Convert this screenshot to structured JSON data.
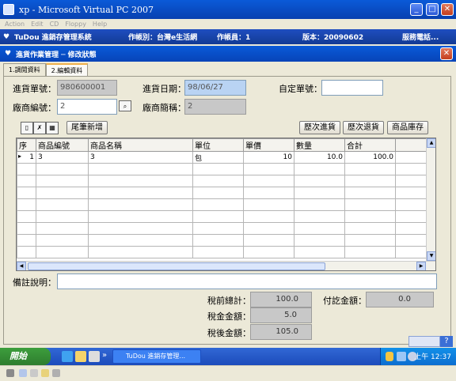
{
  "vpc": {
    "title": "xp - Microsoft Virtual PC 2007",
    "menu": [
      "Action",
      "Edit",
      "CD",
      "Floppy",
      "Help"
    ]
  },
  "app": {
    "system_name": "TuDou 進銷存管理系統",
    "account": "作帳別：台灣e生活網",
    "operator": "作帳員：1",
    "version": "版本：20090602",
    "service_phone": "服務電話..."
  },
  "window": {
    "title": "進貨作業管理 ─ 修改狀態"
  },
  "tabs": [
    "1.調閱資料",
    "2.編輯資料"
  ],
  "form": {
    "purchase_no_label": "進貨單號：",
    "purchase_no": "980600001",
    "purchase_date_label": "進貨日期：",
    "purchase_date": "98/06/27",
    "custom_no_label": "自定單號：",
    "custom_no": "",
    "vendor_no_label": "廠商編號：",
    "vendor_no": "2",
    "vendor_name_label": "廠商簡稱：",
    "vendor_name": "2"
  },
  "toolbar": {
    "new_row_label": "尾筆新增",
    "history_purchase": "歷次進貨",
    "history_return": "歷次退貨",
    "stock_label": "商品庫存"
  },
  "grid": {
    "columns": [
      "序",
      "商品編號",
      "商品名稱",
      "單位",
      "單價",
      "數量",
      "合計"
    ],
    "rows": [
      [
        "1",
        "3",
        "3",
        "包",
        "10",
        "10.0",
        "100.0"
      ]
    ]
  },
  "remarks": {
    "label": "備註說明：",
    "value": ""
  },
  "totals": {
    "pretax_label": "稅前總計：",
    "pretax": "100.0",
    "paid_label": "付訖金額：",
    "paid": "0.0",
    "tax_label": "稅金金額：",
    "tax": "5.0",
    "aftertax_label": "稅後金額：",
    "aftertax": "105.0"
  },
  "taskbar": {
    "start_label": "開始",
    "task_label": "TuDou 進銷存管理...",
    "clock": "上午 12:37",
    "chevron": "»"
  },
  "colors": {
    "title_blue": "#0a5ad8",
    "readonly_gray": "#c8c8c8",
    "selected_field": "#b9d3f3",
    "start_green": "#3d9e3d"
  }
}
